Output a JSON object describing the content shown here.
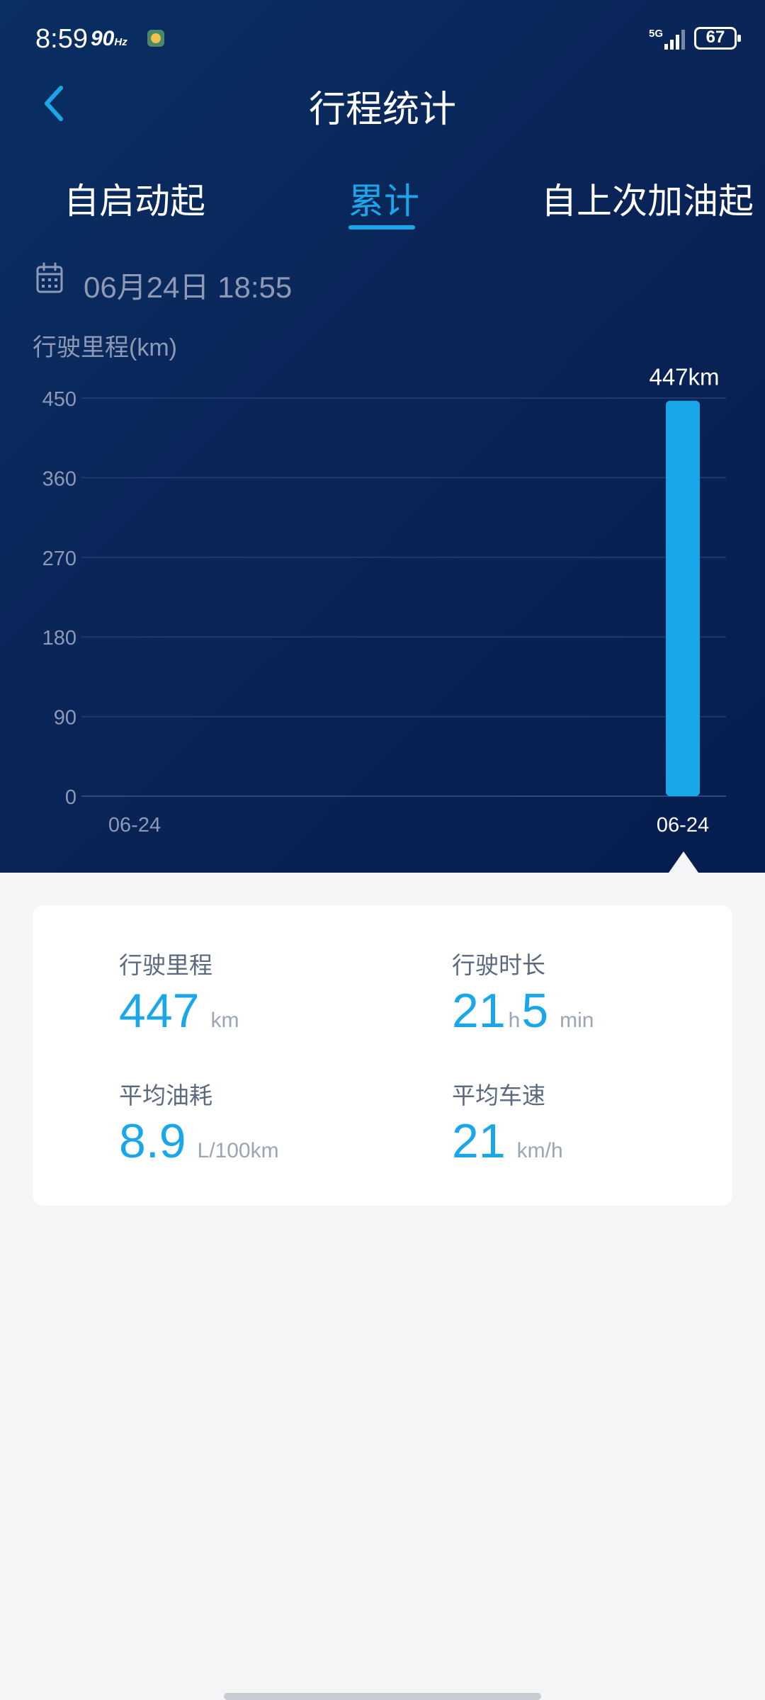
{
  "status_bar": {
    "time": "8:59",
    "refresh": "90",
    "refresh_unit": "Hz",
    "network": "5G",
    "battery": "67"
  },
  "app_bar": {
    "title": "行程统计"
  },
  "tabs": [
    {
      "label": "自启动起",
      "selected": false
    },
    {
      "label": "累计",
      "selected": true
    },
    {
      "label": "自上次加油起",
      "selected": false
    }
  ],
  "date": "06月24日 18:55",
  "chart_data": {
    "type": "bar",
    "ylabel": "行驶里程(km)",
    "ylim": [
      0,
      450
    ],
    "yticks": [
      0,
      90,
      180,
      270,
      360,
      450
    ],
    "categories": [
      "06-24",
      "06-24"
    ],
    "values": [
      0,
      447
    ],
    "value_labels": [
      "",
      "447km"
    ],
    "highlighted_index": 1,
    "grid": true,
    "bar_color": "#1aa7ea"
  },
  "stats": {
    "mileage": {
      "label": "行驶里程",
      "value": "447",
      "unit": "km"
    },
    "duration": {
      "label": "行驶时长",
      "hours": "21",
      "hours_unit": "h",
      "minutes": "5",
      "minutes_unit": "min"
    },
    "fuel": {
      "label": "平均油耗",
      "value": "8.9",
      "unit": "L/100km"
    },
    "speed": {
      "label": "平均车速",
      "value": "21",
      "unit": "km/h"
    }
  },
  "colors": {
    "accent": "#1aa7ea",
    "header_bg": "#0a2558",
    "page_bg": "#f4f5f7"
  }
}
